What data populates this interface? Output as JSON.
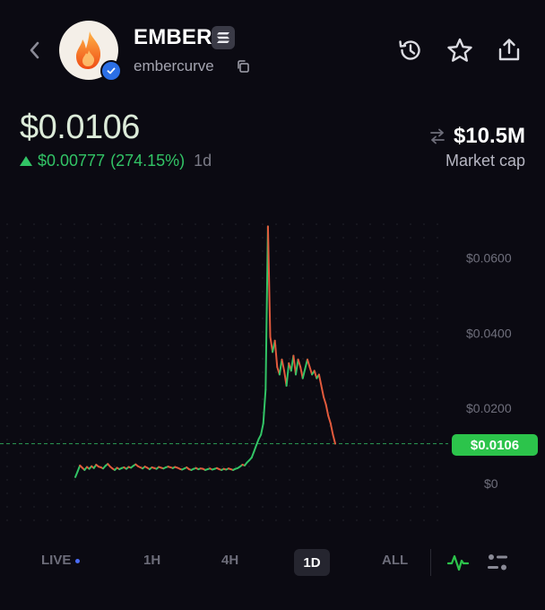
{
  "header": {
    "token_name": "EMBER",
    "handle": "embercurve",
    "icons": {
      "back": "chevron-left-icon",
      "avatar": "flame-icon",
      "verified": "check-badge-icon",
      "chain": "solana-icon",
      "copy": "copy-icon",
      "history": "history-icon",
      "favorite": "star-icon",
      "share": "share-icon"
    }
  },
  "price": {
    "current": "$0.0106",
    "change_abs": "$0.00777",
    "change_pct": "(274.15%)",
    "period": "1d",
    "direction": "up"
  },
  "market_cap": {
    "value": "$10.5M",
    "label": "Market cap"
  },
  "chart_data": {
    "type": "line",
    "y_ticks": [
      "$0.0600",
      "$0.0400",
      "$0.0200",
      "$0"
    ],
    "ylim": [
      0,
      0.07
    ],
    "current_price_label": "$0.0106",
    "current_price": 0.0106,
    "grid": true,
    "points": [
      0.0017,
      0.0032,
      0.0048,
      0.0042,
      0.0036,
      0.0044,
      0.0039,
      0.0046,
      0.0041,
      0.005,
      0.0045,
      0.0043,
      0.004,
      0.0047,
      0.0052,
      0.0045,
      0.004,
      0.0036,
      0.0042,
      0.0038,
      0.0041,
      0.0043,
      0.0039,
      0.0044,
      0.0042,
      0.0047,
      0.0051,
      0.0046,
      0.0043,
      0.004,
      0.0045,
      0.0042,
      0.0038,
      0.0043,
      0.0041,
      0.0039,
      0.0044,
      0.0042,
      0.004,
      0.0043,
      0.0045,
      0.0043,
      0.0041,
      0.0044,
      0.0042,
      0.0039,
      0.0037,
      0.004,
      0.0043,
      0.0038,
      0.0036,
      0.0039,
      0.0041,
      0.0038,
      0.004,
      0.0039,
      0.0036,
      0.0038,
      0.004,
      0.0037,
      0.0039,
      0.0041,
      0.0038,
      0.0036,
      0.0039,
      0.0037,
      0.004,
      0.0038,
      0.0036,
      0.0039,
      0.0041,
      0.0045,
      0.005,
      0.0048,
      0.0056,
      0.0062,
      0.0069,
      0.0085,
      0.0102,
      0.0118,
      0.013,
      0.016,
      0.025,
      0.0684,
      0.039,
      0.035,
      0.038,
      0.031,
      0.029,
      0.033,
      0.03,
      0.026,
      0.032,
      0.03,
      0.034,
      0.029,
      0.033,
      0.031,
      0.028,
      0.0305,
      0.033,
      0.031,
      0.029,
      0.03,
      0.028,
      0.029,
      0.026,
      0.023,
      0.021,
      0.018,
      0.016,
      0.013,
      0.0106
    ]
  },
  "timeframes": [
    {
      "label": "LIVE",
      "live_dot": true
    },
    {
      "label": "1H"
    },
    {
      "label": "4H"
    },
    {
      "label": "1D",
      "active": true
    },
    {
      "label": "ALL"
    }
  ],
  "chart_tools": {
    "line_chart_icon": "line-chart-icon",
    "settings_icon": "chart-settings-icon"
  },
  "colors": {
    "background": "#0b0a12",
    "up": "#32c466",
    "down": "#e25a3c",
    "price_tag": "#2cc44b",
    "accent_orange": "#f26a1b"
  }
}
